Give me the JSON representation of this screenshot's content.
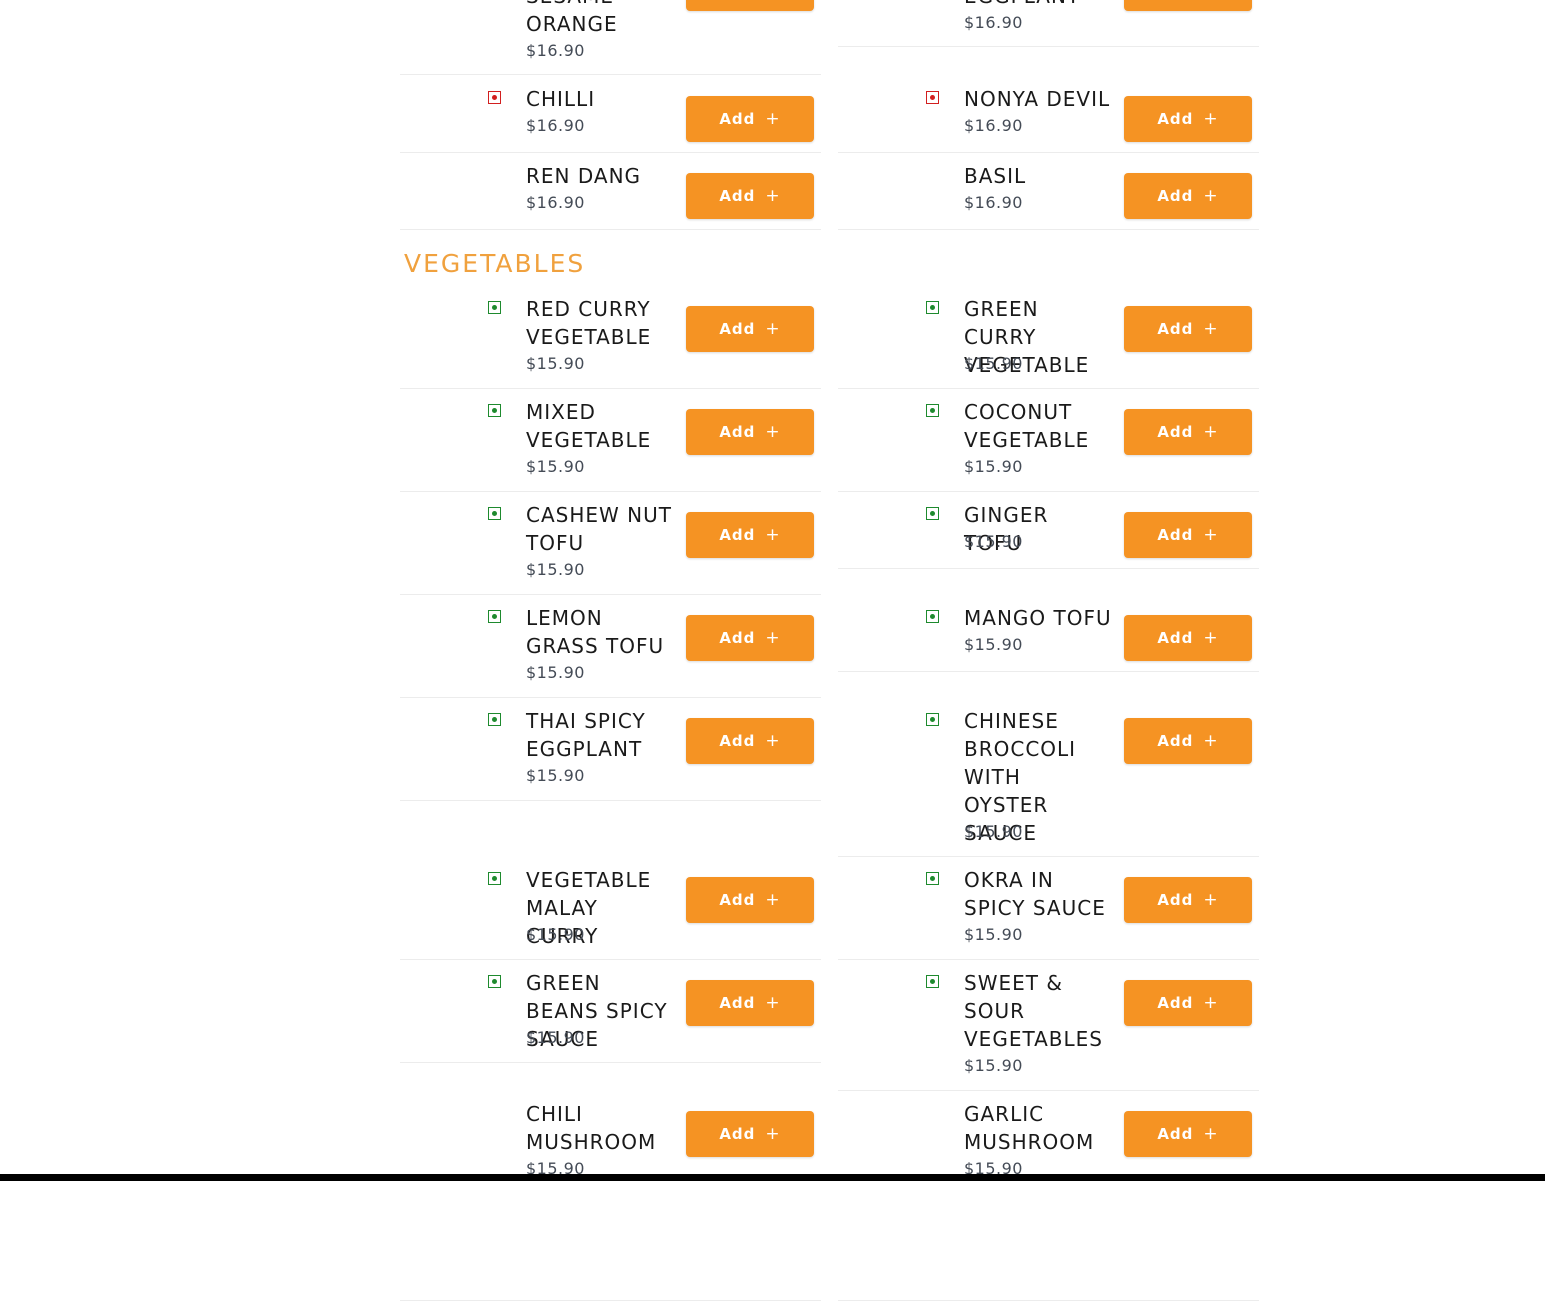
{
  "add_label": "Add",
  "plus_glyph": "+",
  "colors": {
    "accent": "#f59323",
    "section_title": "#f0a13e",
    "veg_mark": "#1e8a2e",
    "nonveg_mark": "#d21f1f"
  },
  "section_vegetables": "VEGETABLES",
  "left_items": [
    {
      "name": "SESAME ORANGE",
      "price": "$16.90",
      "mark": ""
    },
    {
      "name": "CHILLI",
      "price": "$16.90",
      "mark": "red"
    },
    {
      "name": "REN DANG",
      "price": "$16.90",
      "mark": ""
    },
    {
      "name": "RED CURRY VEGETABLE",
      "price": "$15.90",
      "mark": "green"
    },
    {
      "name": "MIXED VEGETABLE",
      "price": "$15.90",
      "mark": "green"
    },
    {
      "name": "CASHEW NUT TOFU",
      "price": "$15.90",
      "mark": "green"
    },
    {
      "name": "LEMON GRASS TOFU",
      "price": "$15.90",
      "mark": "green"
    },
    {
      "name": "THAI SPICY EGGPLANT",
      "price": "$15.90",
      "mark": "green"
    },
    {
      "name": "VEGETABLE MALAY CURRY",
      "price": "$15.90",
      "mark": "green"
    },
    {
      "name": "GREEN BEANS SPICY SAUCE",
      "price": "$15.90",
      "mark": "green"
    },
    {
      "name": "CHILI MUSHROOM",
      "price": "$15.90",
      "mark": ""
    }
  ],
  "right_items": [
    {
      "name": "EGGPLANT",
      "price": "$16.90",
      "mark": ""
    },
    {
      "name": "NONYA DEVIL",
      "price": "$16.90",
      "mark": "red"
    },
    {
      "name": "BASIL",
      "price": "$16.90",
      "mark": ""
    },
    {
      "name": "GREEN CURRY VEGETABLE",
      "price": "$15.90",
      "mark": "green"
    },
    {
      "name": "COCONUT VEGETABLE",
      "price": "$15.90",
      "mark": "green"
    },
    {
      "name": "GINGER TOFU",
      "price": "$15.90",
      "mark": "green"
    },
    {
      "name": "MANGO TOFU",
      "price": "$15.90",
      "mark": "green"
    },
    {
      "name": "CHINESE BROCCOLI WITH OYSTER SAUCE",
      "price": "$15.90",
      "mark": "green"
    },
    {
      "name": "OKRA IN SPICY SAUCE",
      "price": "$15.90",
      "mark": "green"
    },
    {
      "name": "SWEET & SOUR VEGETABLES",
      "price": "$15.90",
      "mark": "green"
    },
    {
      "name": "GARLIC MUSHROOM",
      "price": "$15.90",
      "mark": ""
    }
  ]
}
